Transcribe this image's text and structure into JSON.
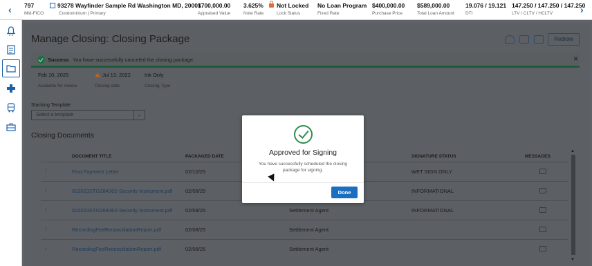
{
  "topbar": {
    "prev_label": "‹",
    "next_label": "›",
    "items": [
      {
        "value": "797",
        "label": "Mid-FICO"
      },
      {
        "value": "93278 Wayfinder Sample Rd Washington MD, 20001",
        "label": "Condominium | Primary"
      },
      {
        "value": "$700,000.00",
        "label": "Appraised Value"
      },
      {
        "value": "3.625%",
        "label": "Note Rate"
      },
      {
        "value": "Not Locked",
        "label": "Lock Status"
      },
      {
        "value": "No Loan Program",
        "label": "Fixed Rate"
      },
      {
        "value": "$400,000.00",
        "label": "Purchase Price"
      },
      {
        "value": "$589,000.00",
        "label": "Total Loan Amount"
      },
      {
        "value": "19.076 / 19.121",
        "label": "DTI"
      },
      {
        "value": "147.250 / 147.250 / 147.250",
        "label": "LTV / CLTV / HCLTV"
      }
    ]
  },
  "sidebar": {
    "icons": [
      "bell-icon",
      "document-list-icon",
      "folder-icon",
      "puzzle-icon",
      "bus-icon",
      "briefcase-icon"
    ],
    "active_index": 2
  },
  "page": {
    "title": "Manage Closing: Closing Package",
    "redraw_label": "Redraw"
  },
  "success": {
    "label": "Success",
    "text": "You have successfully canceled the closing package.",
    "close_label": "×"
  },
  "meta": [
    {
      "value": "Feb 10, 2025",
      "label": "Available for review"
    },
    {
      "value": "Jul 13, 2022",
      "label": "Closing date",
      "warning": true
    },
    {
      "value": "Ink Only",
      "label": "Closing Type"
    }
  ],
  "stacking": {
    "label": "Stacking Template",
    "placeholder": "Select a template",
    "dropdown_glyph": "⌄"
  },
  "documents": {
    "title": "Closing Documents",
    "columns": [
      "DOCUMENT TITLE",
      "PACKAGED DATE",
      "",
      "SIGNATURE STATUS",
      "MESSAGES"
    ],
    "rows": [
      {
        "title": "First Payment Letter",
        "date": "02/10/25",
        "party": "",
        "status": "WET SIGN ONLY"
      },
      {
        "title": "022023STG284362-Security Instrument.pdf",
        "date": "02/08/25",
        "party": "",
        "status": "INFORMATIONAL"
      },
      {
        "title": "022023STG284362-Security Instrument.pdf",
        "date": "02/08/25",
        "party": "Settlement Agent",
        "status": "INFORMATIONAL"
      },
      {
        "title": "RecordingFeeReconciliationReport.pdf",
        "date": "02/08/25",
        "party": "Settlement Agent",
        "status": ""
      },
      {
        "title": "RecordingFeeReconciliationReport.pdf",
        "date": "02/08/25",
        "party": "Settlement Agent",
        "status": ""
      }
    ]
  },
  "modal": {
    "title": "Approved for Signing",
    "body": "You have successfully scheduled the closing package for signing.",
    "done_label": "Done"
  },
  "colors": {
    "accent": "#1a6fc0",
    "success": "#2e8b4f",
    "warning": "#b8641f",
    "overlay": "#5f6266"
  }
}
